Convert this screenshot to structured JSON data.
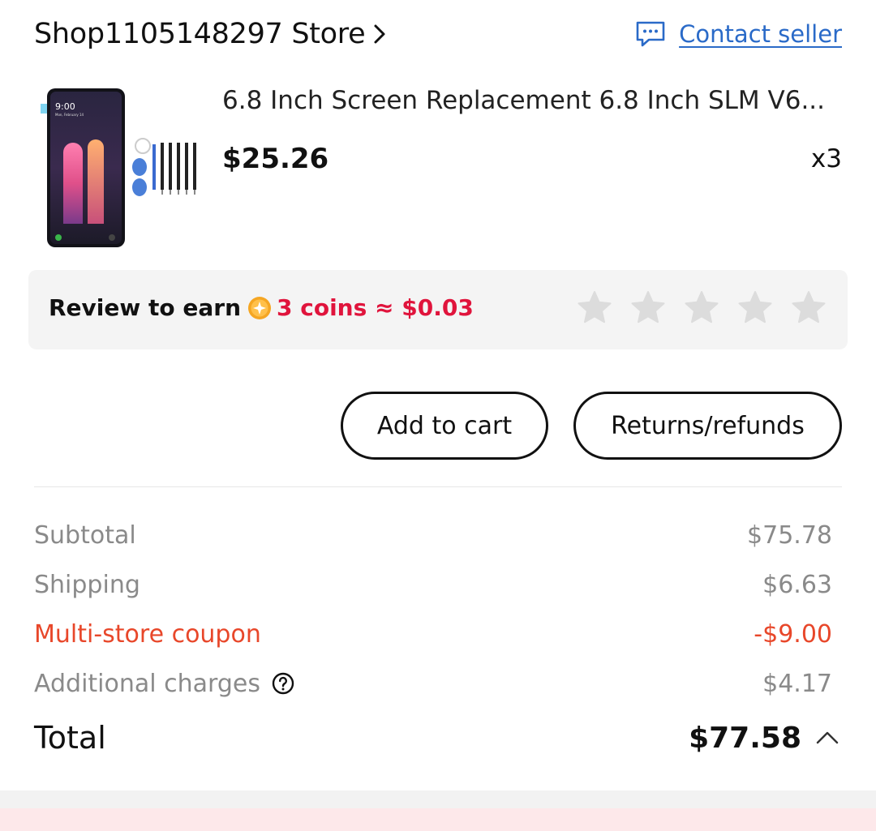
{
  "store": {
    "name": "Shop1105148297 Store",
    "contact_label": "Contact seller"
  },
  "product": {
    "title": "6.8 Inch Screen Replacement 6.8 Inch SLM V6...",
    "price": "$25.26",
    "quantity": "x3",
    "thumb_time": "9:00",
    "thumb_date": "Mon, February 14"
  },
  "review": {
    "label": "Review to earn",
    "reward": "3 coins ≈ $0.03",
    "rating": 0,
    "max_rating": 5
  },
  "actions": {
    "add_to_cart": "Add to cart",
    "returns": "Returns/refunds"
  },
  "summary": {
    "subtotal_label": "Subtotal",
    "subtotal_value": "$75.78",
    "shipping_label": "Shipping",
    "shipping_value": "$6.63",
    "coupon_label": "Multi-store coupon",
    "coupon_value": "-$9.00",
    "additional_label": "Additional charges",
    "additional_value": "$4.17",
    "total_label": "Total",
    "total_value": "$77.58"
  },
  "colors": {
    "link": "#2a6ac8",
    "reward": "#e0143c",
    "coupon": "#e8472a",
    "muted": "#8a8a8a",
    "star": "#dcdcdc",
    "coin": "#f5a623"
  },
  "icons": {
    "store_chevron": "chevron-right-icon",
    "contact": "chat-bubble-icon",
    "coin": "coin-icon",
    "star": "star-icon",
    "help": "question-circle-icon",
    "total_toggle": "chevron-up-icon"
  }
}
